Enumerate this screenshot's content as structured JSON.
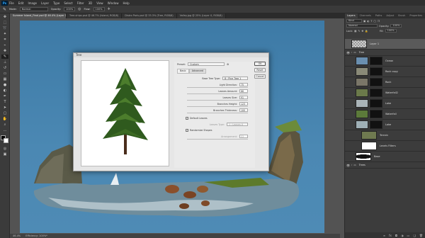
{
  "menubar": {
    "logo": "Ps",
    "items": [
      "File",
      "Edit",
      "Image",
      "Layer",
      "Type",
      "Select",
      "Filter",
      "3D",
      "View",
      "Window",
      "Help"
    ]
  },
  "options": {
    "mode_label": "Mode:",
    "mode_value": "Normal",
    "opacity_label": "Opacity:",
    "opacity_value": "100%",
    "flow_label": "Flow:",
    "flow_value": "100%"
  },
  "doc_tabs": [
    "Summer Island_Final.psd @ 46.4% (Layer 1, RGB/8)",
    "Tree-ships.psd @ 46.7% (Island, RGB/8)",
    "Distro Paris.psd @ 33.3% (Tree, RGB/8)",
    "Valley.jpg @ 25% (Layer 0, RGB/8)"
  ],
  "status": {
    "zoom": "46.4%",
    "info": "Efficiency: 100%*"
  },
  "panel": {
    "tabs": [
      "Layers",
      "Channels",
      "Paths",
      "Adjust",
      "Brush",
      "Properties"
    ],
    "kind_label": "Kind",
    "blend": "Normal",
    "opacity_label": "Opacity:",
    "opacity_value": "100%",
    "lock_label": "Lock:",
    "fill_label": "Fill:",
    "fill_value": "100%",
    "layers": [
      {
        "name": "Layer 1",
        "selected": true,
        "has_mask": false
      },
      {
        "name": "Tree",
        "group": true
      },
      {
        "name": "Ocean",
        "has_mask": true
      },
      {
        "name": "Rock copy",
        "has_mask": true
      },
      {
        "name": "Rock",
        "has_mask": true
      },
      {
        "name": "Waterfall2",
        "has_mask": true
      },
      {
        "name": "Lake",
        "has_mask": true
      },
      {
        "name": "Waterfall",
        "has_mask": true
      },
      {
        "name": "Lake",
        "has_mask": true
      },
      {
        "name": "Terrain",
        "has_mask": false
      },
      {
        "name": "Levels Filters",
        "has_mask": true
      },
      {
        "name": "Base",
        "has_mask": false
      },
      {
        "name": "Trees",
        "group": true
      }
    ]
  },
  "dialog": {
    "title": "Tree",
    "preset_label": "Preset:",
    "preset_value": "Custom",
    "tab_basic": "Basic",
    "tab_advanced": "Advanced",
    "base_type_label": "Base Tree Type:",
    "base_type_value": "8 : Pine Tree 1",
    "controls": [
      {
        "label": "Light Direction:",
        "value": "75"
      },
      {
        "label": "Leaves Amount:",
        "value": "66"
      },
      {
        "label": "Leaves Size:",
        "value": "91"
      },
      {
        "label": "Branches Height:",
        "value": "123"
      },
      {
        "label": "Branches Thickness:",
        "value": "100"
      }
    ],
    "default_leaves": "Default Leaves",
    "leaves_type_label": "Leaves Type:",
    "leaves_type_value": "1 : Leaves 0",
    "randomize": "Randomize Shapes",
    "arrangement_label": "Arrangement:",
    "arrangement_value": "53",
    "ok": "OK",
    "reset": "Reset",
    "cancel": "Cancel"
  }
}
